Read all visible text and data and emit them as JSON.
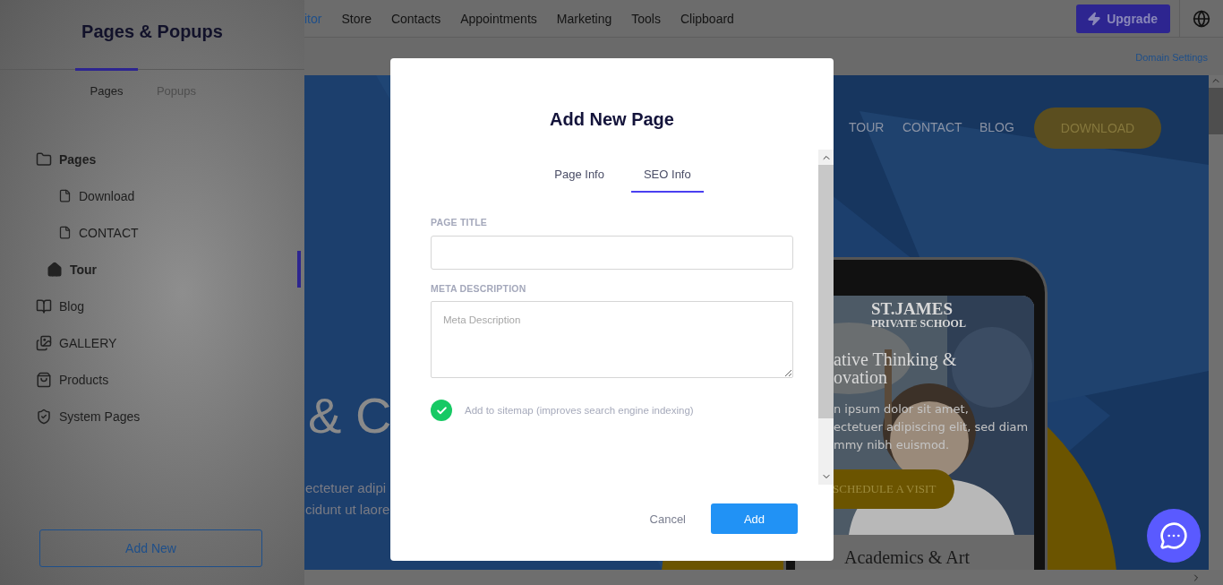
{
  "top_nav": {
    "items": [
      {
        "label": "itor",
        "selected": true
      },
      {
        "label": "Store",
        "selected": false
      },
      {
        "label": "Contacts",
        "selected": false
      },
      {
        "label": "Appointments",
        "selected": false
      },
      {
        "label": "Marketing",
        "selected": false
      },
      {
        "label": "Tools",
        "selected": false
      },
      {
        "label": "Clipboard",
        "selected": false
      }
    ],
    "upgrade_button": "Upgrade"
  },
  "sidebar": {
    "title": "Pages & Popups",
    "tabs": [
      {
        "label": "Pages",
        "selected": true
      },
      {
        "label": "Popups",
        "selected": false
      }
    ],
    "tree": [
      {
        "label": "Pages",
        "kind": "folder",
        "selected": false,
        "children": [
          {
            "label": "Download",
            "kind": "page",
            "selected": false
          },
          {
            "label": "CONTACT",
            "kind": "page",
            "selected": false
          }
        ]
      },
      {
        "label": "Tour",
        "kind": "home",
        "selected": true
      },
      {
        "label": "Blog",
        "kind": "blog",
        "selected": false
      },
      {
        "label": "GALLERY",
        "kind": "gallery",
        "selected": false
      },
      {
        "label": "Products",
        "kind": "products",
        "selected": false
      },
      {
        "label": "System Pages",
        "kind": "system",
        "selected": false
      }
    ],
    "add_button": "Add New"
  },
  "toolbar": {
    "link": "Domain Settings"
  },
  "preview": {
    "nav": [
      "TOUR",
      "CONTACT",
      "BLOG"
    ],
    "download_button": "DOWNLOAD",
    "headline": "& C",
    "body_lines": [
      "ectetuer adipi",
      "cidunt ut laore"
    ],
    "phone": {
      "school_name": "ST.JAMES",
      "school_subtitle": "PRIVATE SCHOOL",
      "headline_lines": [
        "ative Thinking &",
        "ovation"
      ],
      "body_lines": [
        "n ipsum dolor sit amet,",
        "ectetuer adipiscing elit, sed diam",
        "mmy nibh euismod."
      ],
      "button": "SCHEDULE A VISIT",
      "section_title": "Academics & Art"
    }
  },
  "modal": {
    "title": "Add New Page",
    "tabs": [
      {
        "label": "Page Info",
        "selected": false
      },
      {
        "label": "SEO Info",
        "selected": true
      }
    ],
    "page_title": {
      "label": "PAGE TITLE"
    },
    "meta_description": {
      "label": "META DESCRIPTION",
      "placeholder": "Meta Description"
    },
    "sitemap": {
      "label": "Add to sitemap (improves search engine indexing)",
      "checked": true
    },
    "cancel_button": "Cancel",
    "add_button": "Add"
  }
}
